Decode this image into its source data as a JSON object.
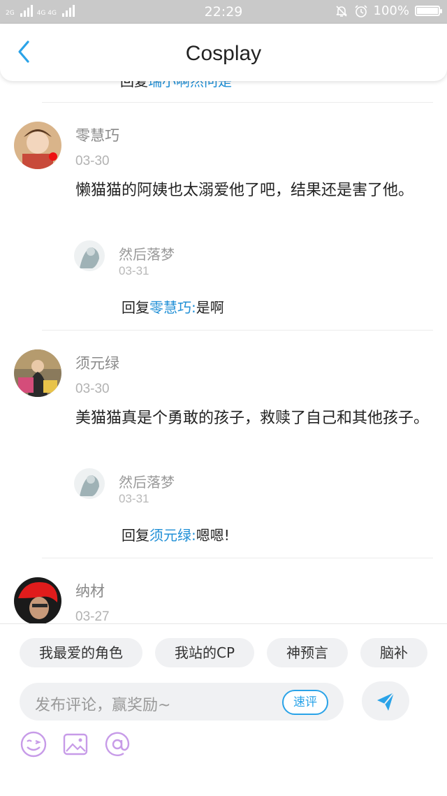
{
  "status_bar": {
    "net_left": "2G",
    "net_right": "4G 4G",
    "time": "22:29",
    "battery_text": "100%",
    "battery_level": 1.0
  },
  "header": {
    "title": "Cosplay",
    "back_icon": "chevron-left-icon"
  },
  "clipped_reply": {
    "prefix": "回复",
    "to": "瑞小啊然问是",
    "text": ""
  },
  "comments": [
    {
      "name": "零慧巧",
      "date": "03-30",
      "text": "懒猫猫的阿姨也太溺爱他了吧，结果还是害了他。",
      "reply": {
        "name": "然后落梦",
        "date": "03-31",
        "prefix": "回复",
        "to": "零慧巧:",
        "text": "是啊"
      }
    },
    {
      "name": "须元绿",
      "date": "03-30",
      "text": "美猫猫真是个勇敢的孩子，救赎了自己和其他孩子。",
      "reply": {
        "name": "然后落梦",
        "date": "03-31",
        "prefix": "回复",
        "to": "须元绿:",
        "text": "嗯嗯!"
      }
    },
    {
      "name": "纳材",
      "date": "03-27"
    }
  ],
  "chips": [
    "我最爱的角色",
    "我站的CP",
    "神预言",
    "脑补"
  ],
  "input": {
    "placeholder": "发布评论，赢奖励~",
    "quick_review": "速评"
  },
  "colors": {
    "accent": "#2aa3e8",
    "highlight": "#1f8fd6",
    "tool_icon": "#c79be8"
  },
  "icons": {
    "send": "send-icon",
    "emoji": "emoji-icon",
    "image": "image-icon",
    "mention": "at-icon"
  }
}
